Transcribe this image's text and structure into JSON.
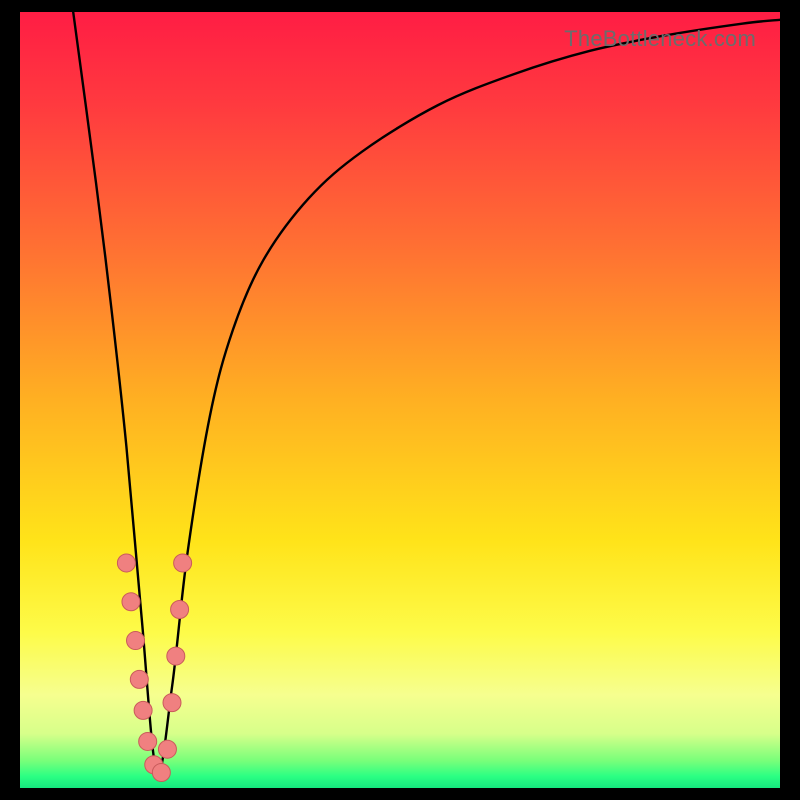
{
  "watermark": "TheBottleneck.com",
  "colors": {
    "gradient_stops": [
      {
        "offset": 0.0,
        "color": "#ff1d44"
      },
      {
        "offset": 0.12,
        "color": "#ff3a3f"
      },
      {
        "offset": 0.3,
        "color": "#ff6f33"
      },
      {
        "offset": 0.5,
        "color": "#ffb022"
      },
      {
        "offset": 0.68,
        "color": "#ffe319"
      },
      {
        "offset": 0.8,
        "color": "#fdfb49"
      },
      {
        "offset": 0.88,
        "color": "#f6ff8f"
      },
      {
        "offset": 0.93,
        "color": "#d7ff8a"
      },
      {
        "offset": 0.965,
        "color": "#78ff7a"
      },
      {
        "offset": 0.985,
        "color": "#2bff83"
      },
      {
        "offset": 1.0,
        "color": "#15e77e"
      }
    ],
    "curve_stroke": "#000000",
    "dot_fill": "#f08080",
    "dot_stroke": "#c95b5b"
  },
  "chart_data": {
    "type": "line",
    "title": "",
    "xlabel": "",
    "ylabel": "",
    "xlim": [
      0,
      100
    ],
    "ylim": [
      0,
      100
    ],
    "curve_minimum_x": 18,
    "series": [
      {
        "name": "bottleneck-curve",
        "x": [
          7,
          10,
          12,
          14,
          16,
          18,
          20,
          22,
          25,
          28,
          32,
          38,
          45,
          55,
          65,
          75,
          85,
          95,
          100
        ],
        "y": [
          100,
          78,
          62,
          44,
          22,
          2,
          13,
          30,
          48,
          59,
          68,
          76,
          82,
          88,
          92,
          95,
          97,
          98.5,
          99
        ]
      }
    ],
    "points": {
      "name": "observed-points",
      "x": [
        14.0,
        14.6,
        15.2,
        15.7,
        16.2,
        16.8,
        17.6,
        18.6,
        19.4,
        20.0,
        20.5,
        21.0,
        21.4
      ],
      "y": [
        29,
        24,
        19,
        14,
        10,
        6,
        3,
        2,
        5,
        11,
        17,
        23,
        29
      ]
    }
  }
}
